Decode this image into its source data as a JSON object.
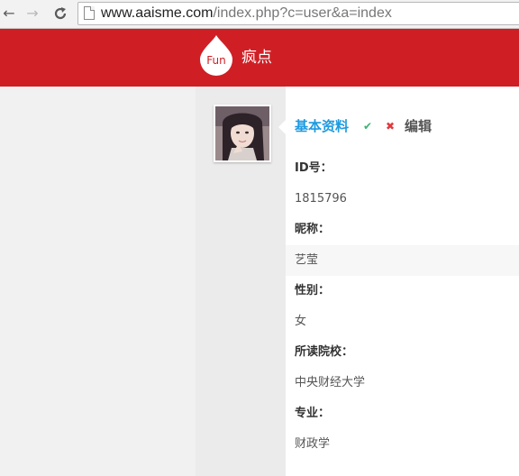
{
  "browser": {
    "back_icon": "back-arrow-icon",
    "forward_icon": "forward-arrow-icon",
    "reload_icon": "reload-icon",
    "url_host": "www.aaisme.com",
    "url_path": "/index.php?c=user&a=index"
  },
  "header": {
    "logo_text": "Fun",
    "brand": "疯点",
    "color": "#cf1f25"
  },
  "profile": {
    "tab_basic": "基本资料",
    "check_glyph": "✔",
    "close_glyph": "✖",
    "tab_edit": "编辑",
    "fields": [
      {
        "label": "ID号：",
        "value": "1815796"
      },
      {
        "label": "昵称：",
        "value": "艺莹"
      },
      {
        "label": "性别：",
        "value": "女"
      },
      {
        "label": "所读院校：",
        "value": "中央财经大学"
      },
      {
        "label": "专业：",
        "value": "财政学"
      }
    ]
  }
}
